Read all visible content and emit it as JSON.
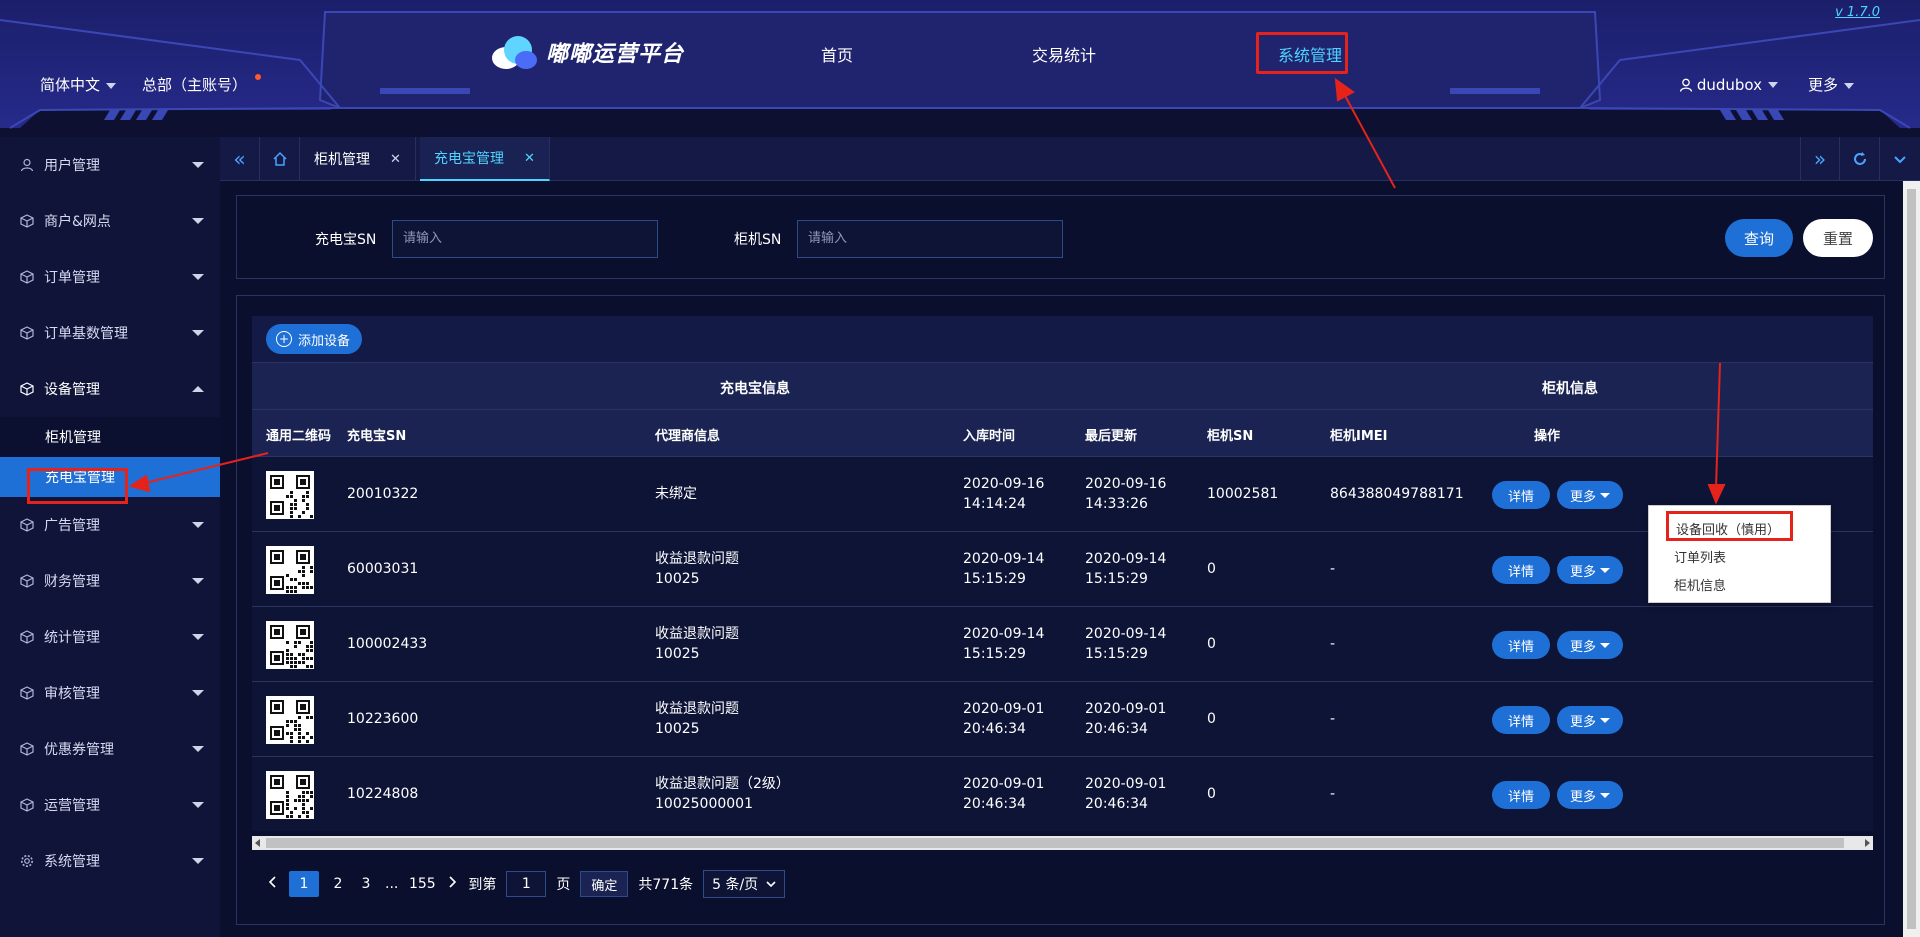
{
  "header": {
    "version": "v 1.7.0",
    "language": "简体中文",
    "account": "总部（主账号）",
    "logo_text": "嘟嘟运营平台",
    "nav": [
      {
        "label": "首页"
      },
      {
        "label": "交易统计"
      },
      {
        "label": "系统管理",
        "active": true
      }
    ],
    "user": "dudubox",
    "more": "更多"
  },
  "sidebar": {
    "items": [
      {
        "label": "用户管理",
        "icon": "user-icon"
      },
      {
        "label": "商户&网点",
        "icon": "cube-icon"
      },
      {
        "label": "订单管理",
        "icon": "cube-icon"
      },
      {
        "label": "订单基数管理",
        "icon": "cube-icon"
      },
      {
        "label": "设备管理",
        "icon": "cube-icon",
        "open": true
      },
      {
        "label": "广告管理",
        "icon": "cube-icon"
      },
      {
        "label": "财务管理",
        "icon": "cube-icon"
      },
      {
        "label": "统计管理",
        "icon": "cube-icon"
      },
      {
        "label": "审核管理",
        "icon": "cube-icon"
      },
      {
        "label": "优惠券管理",
        "icon": "cube-icon"
      },
      {
        "label": "运营管理",
        "icon": "cube-icon"
      },
      {
        "label": "系统管理",
        "icon": "gear-icon"
      }
    ],
    "sub_items": [
      {
        "label": "柜机管理"
      },
      {
        "label": "充电宝管理",
        "active": true
      }
    ]
  },
  "tabs": [
    {
      "label": "柜机管理"
    },
    {
      "label": "充电宝管理",
      "active": true
    }
  ],
  "search": {
    "powerbank_sn_label": "充电宝SN",
    "powerbank_sn_placeholder": "请输入",
    "cabinet_sn_label": "柜机SN",
    "cabinet_sn_placeholder": "请输入",
    "query_label": "查询",
    "reset_label": "重置"
  },
  "table": {
    "add_label": "添加设备",
    "group_headers": {
      "powerbank": "充电宝信息",
      "cabinet": "柜机信息"
    },
    "columns": [
      "通用二维码",
      "充电宝SN",
      "代理商信息",
      "入库时间",
      "最后更新",
      "柜机SN",
      "柜机IMEI",
      "操作"
    ],
    "rows": [
      {
        "sn": "20010322",
        "agent": "未绑定",
        "agent_id": "",
        "in_date": "2020-09-16",
        "in_time": "14:14:24",
        "up_date": "2020-09-16",
        "up_time": "14:33:26",
        "cabinet_sn": "10002581",
        "imei": "864388049788171"
      },
      {
        "sn": "60003031",
        "agent": "收益退款问题",
        "agent_id": "10025",
        "in_date": "2020-09-14",
        "in_time": "15:15:29",
        "up_date": "2020-09-14",
        "up_time": "15:15:29",
        "cabinet_sn": "0",
        "imei": "-"
      },
      {
        "sn": "100002433",
        "agent": "收益退款问题",
        "agent_id": "10025",
        "in_date": "2020-09-14",
        "in_time": "15:15:29",
        "up_date": "2020-09-14",
        "up_time": "15:15:29",
        "cabinet_sn": "0",
        "imei": "-"
      },
      {
        "sn": "10223600",
        "agent": "收益退款问题",
        "agent_id": "10025",
        "in_date": "2020-09-01",
        "in_time": "20:46:34",
        "up_date": "2020-09-01",
        "up_time": "20:46:34",
        "cabinet_sn": "0",
        "imei": "-"
      },
      {
        "sn": "10224808",
        "agent": "收益退款问题（2级）",
        "agent_id": "10025000001",
        "in_date": "2020-09-01",
        "in_time": "20:46:34",
        "up_date": "2020-09-01",
        "up_time": "20:46:34",
        "cabinet_sn": "0",
        "imei": "-"
      }
    ],
    "detail_label": "详情",
    "more_label": "更多"
  },
  "more_menu": {
    "items": [
      "设备回收（慎用）",
      "订单列表",
      "柜机信息"
    ]
  },
  "pagination": {
    "pages": [
      "1",
      "2",
      "3",
      "...",
      "155"
    ],
    "goto_label": "到第",
    "current": "1",
    "page_suffix": "页",
    "confirm_label": "确定",
    "total_label": "共771条",
    "page_size": "5 条/页"
  },
  "colors": {
    "accent": "#1e6fd6",
    "active_text": "#4fd3ff",
    "annotation": "#e5231b",
    "background": "#0b0f2e"
  }
}
